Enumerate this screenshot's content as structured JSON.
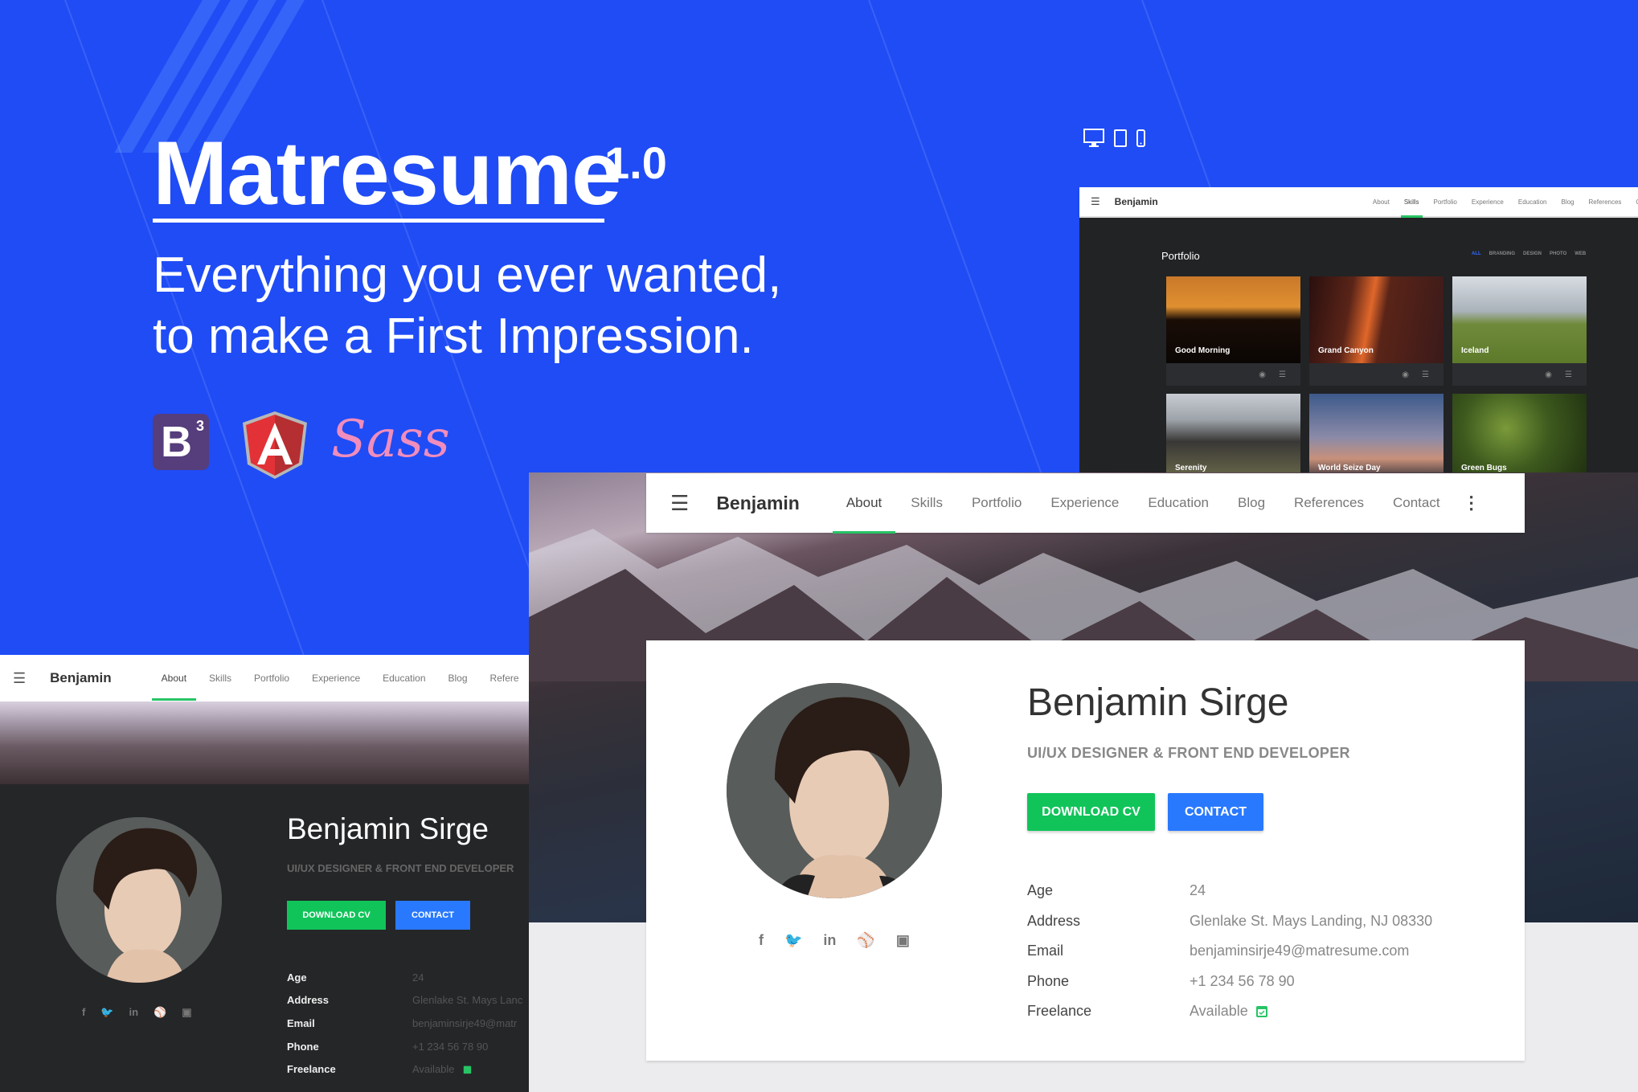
{
  "hero": {
    "title": "Matresume",
    "version": "1.0",
    "tagline_line1": "Everything you ever wanted,",
    "tagline_line2": "to make a First Impression.",
    "logos": [
      {
        "name": "bootstrap-logo",
        "label": "B",
        "sup": "3"
      },
      {
        "name": "angular-logo",
        "label": "A"
      },
      {
        "name": "sass-logo",
        "label": "Sass"
      }
    ],
    "device_icons": [
      "desktop-icon",
      "tablet-icon",
      "phone-icon"
    ]
  },
  "colors": {
    "background": "#1f4cf5",
    "accent_green": "#27c465",
    "download_button": "#10c45a",
    "contact_button": "#2979ff"
  },
  "nav": {
    "brand": "Benjamin",
    "items": [
      "About",
      "Skills",
      "Portfolio",
      "Experience",
      "Education",
      "Blog",
      "References",
      "Contact"
    ],
    "left_window_items": [
      "About",
      "Skills",
      "Portfolio",
      "Experience",
      "Education",
      "Blog",
      "Refere"
    ]
  },
  "portfolio_window": {
    "active_nav": "Skills",
    "title": "Portfolio",
    "filters": [
      "ALL",
      "BRANDING",
      "DESIGN",
      "PHOTO",
      "WEB"
    ],
    "active_filter": "ALL",
    "items": [
      {
        "title": "Good Morning"
      },
      {
        "title": "Grand Canyon"
      },
      {
        "title": "Iceland"
      },
      {
        "title": "Serenity"
      },
      {
        "title": "World Seize Day"
      },
      {
        "title": "Green Bugs"
      }
    ]
  },
  "profile": {
    "active_nav": "About",
    "name": "Benjamin Sirge",
    "role": "UI/UX DESIGNER & FRONT END DEVELOPER",
    "download_label": "DOWNLOAD CV",
    "contact_label": "CONTACT",
    "social": [
      "facebook",
      "twitter",
      "linkedin",
      "dribbble",
      "instagram"
    ],
    "info": [
      {
        "label": "Age",
        "value": "24"
      },
      {
        "label": "Address",
        "value": "Glenlake St. Mays Landing, NJ 08330"
      },
      {
        "label": "Email",
        "value": "benjaminsirje49@matresume.com"
      },
      {
        "label": "Phone",
        "value": "+1 234 56 78 90"
      },
      {
        "label": "Freelance",
        "value": "Available"
      }
    ]
  },
  "left_window": {
    "role": "UI/UX DESIGNER & FRONT END DEVELOPER",
    "download_label": "DOWNLOAD CV",
    "contact_label": "CONTACT",
    "info": [
      {
        "label": "Age",
        "value": "24"
      },
      {
        "label": "Address",
        "value": "Glenlake St. Mays Lanc"
      },
      {
        "label": "Email",
        "value": "benjaminsirje49@matr"
      },
      {
        "label": "Phone",
        "value": "+1 234 56 78 90"
      },
      {
        "label": "Freelance",
        "value": "Available"
      }
    ]
  }
}
